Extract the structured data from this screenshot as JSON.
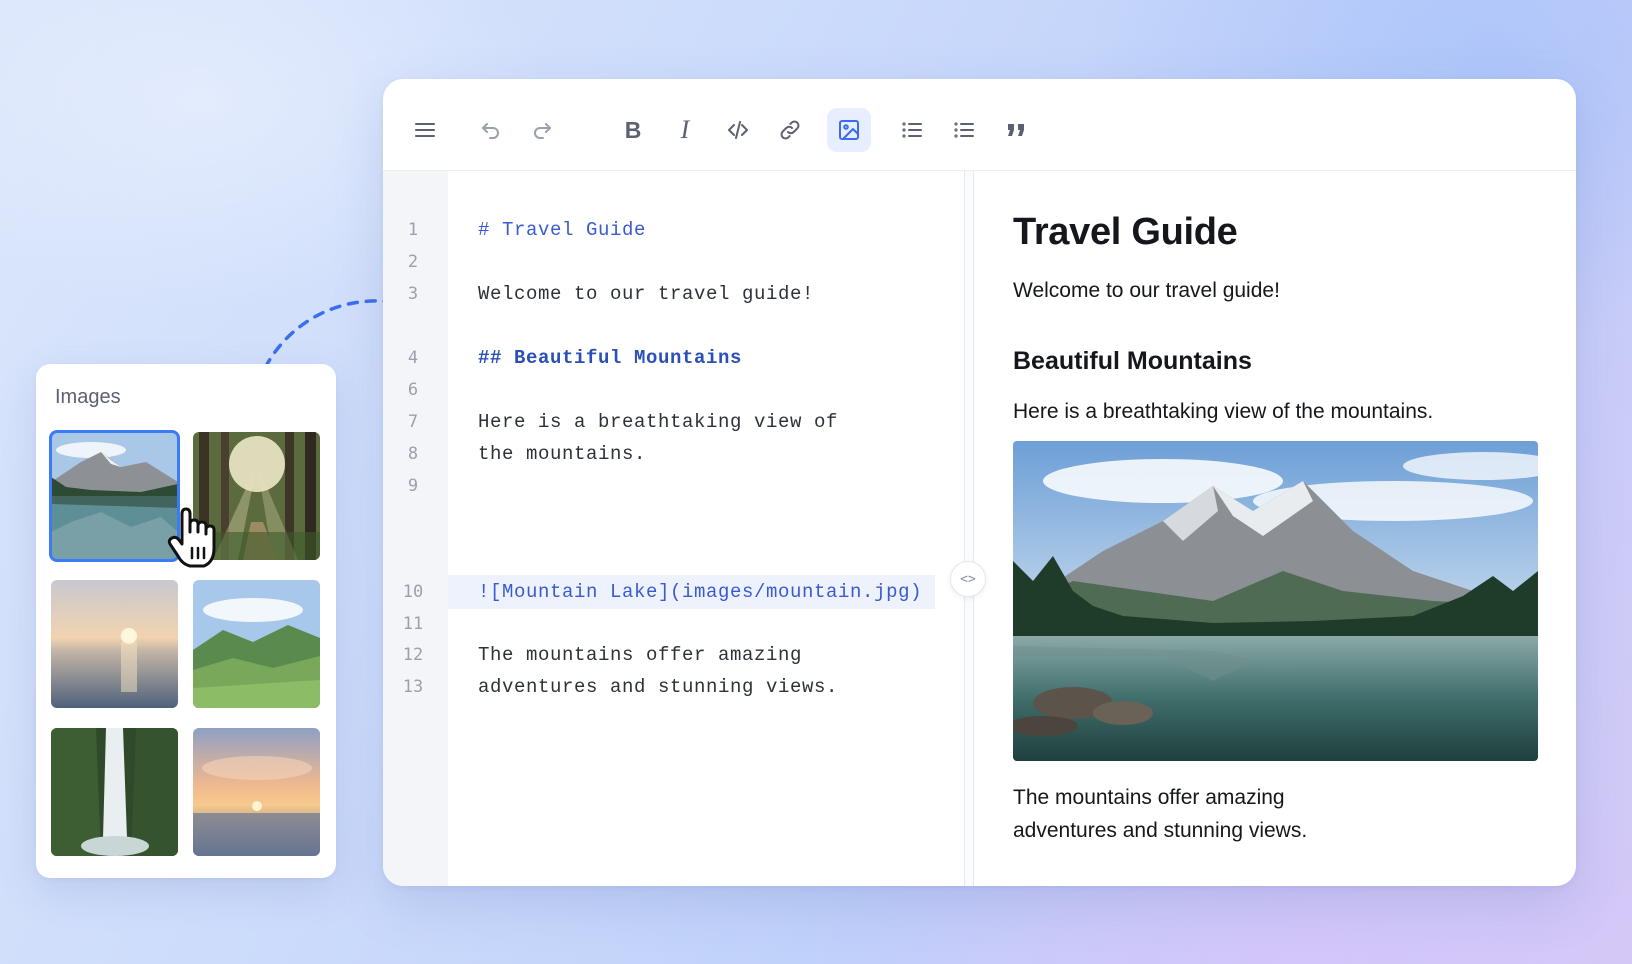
{
  "toolbar": {
    "buttons": [
      {
        "name": "menu-icon"
      },
      {
        "name": "undo-icon"
      },
      {
        "name": "redo-icon"
      },
      {
        "name": "bold-icon",
        "label": "B"
      },
      {
        "name": "italic-icon",
        "label": "I"
      },
      {
        "name": "code-icon"
      },
      {
        "name": "link-icon"
      },
      {
        "name": "image-icon",
        "active": true
      },
      {
        "name": "bullet-list-icon"
      },
      {
        "name": "ordered-list-icon"
      },
      {
        "name": "quote-icon"
      }
    ],
    "active_color": "#3b6cf2"
  },
  "source": {
    "lines": [
      {
        "num": "1",
        "text": "# Travel Guide"
      },
      {
        "num": "2",
        "text": ""
      },
      {
        "num": "3",
        "text": "Welcome to our travel guide!"
      },
      {
        "num": "4",
        "text": "## Beautiful Mountains"
      },
      {
        "num": "6",
        "text": ""
      },
      {
        "num": "7",
        "text": "Here is a breathtaking view of"
      },
      {
        "num": "8",
        "text": "the mountains."
      },
      {
        "num": "9",
        "text": ""
      },
      {
        "num": "10",
        "text": "![Mountain Lake](images/mountain.jpg)"
      },
      {
        "num": "11",
        "text": ""
      },
      {
        "num": "12",
        "text": "The mountains offer amazing"
      },
      {
        "num": "13",
        "text": "adventures and stunning views."
      }
    ],
    "highlighted_line": "10"
  },
  "preview": {
    "h1": "Travel Guide",
    "p1": "Welcome to our travel guide!",
    "h2": "Beautiful Mountains",
    "p2": "Here is a breathtaking view of the mountains.",
    "p3_line1": "The mountains offer amazing",
    "p3_line2": "adventures and stunning views."
  },
  "images_panel": {
    "title": "Images",
    "thumbnails": [
      "mountain-lake",
      "forest-sunbeams",
      "ocean-sunset",
      "green-valley",
      "waterfall",
      "pastel-sunset"
    ],
    "selected": "mountain-lake"
  },
  "colors": {
    "accent": "#3b7bf5",
    "heading_code": "#3a5bd0"
  }
}
